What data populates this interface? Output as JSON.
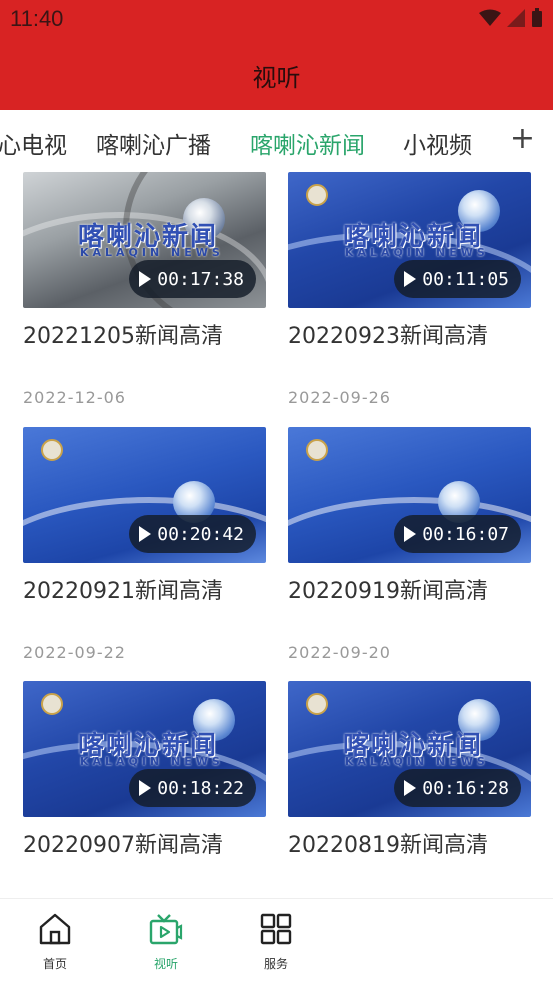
{
  "status_bar": {
    "time": "11:40"
  },
  "header": {
    "title": "视听"
  },
  "tabs": [
    {
      "label": "心电视"
    },
    {
      "label": "喀喇沁广播"
    },
    {
      "label": "喀喇沁新闻",
      "active": true
    },
    {
      "label": "小视频"
    }
  ],
  "tab_add_label": "+",
  "thumbnail_logo": {
    "title": "喀喇沁新闻",
    "subtitle": "KALAQIN NEWS"
  },
  "videos": [
    {
      "title": "20221205新闻高清",
      "duration": "00:17:38",
      "date": "2022-12-06"
    },
    {
      "title": "20220923新闻高清",
      "duration": "00:11:05",
      "date": "2022-09-26"
    },
    {
      "title": "20220921新闻高清",
      "duration": "00:20:42",
      "date": "2022-09-22"
    },
    {
      "title": "20220919新闻高清",
      "duration": "00:16:07",
      "date": "2022-09-20"
    },
    {
      "title": "20220907新闻高清",
      "duration": "00:18:22"
    },
    {
      "title": "20220819新闻高清",
      "duration": "00:16:28"
    }
  ],
  "bottom_nav": [
    {
      "label": "首页",
      "icon": "home-icon"
    },
    {
      "label": "视听",
      "icon": "tv-icon",
      "active": true
    },
    {
      "label": "服务",
      "icon": "grid-icon"
    }
  ],
  "colors": {
    "brand_red": "#d82323",
    "accent_green": "#2aa56b"
  }
}
